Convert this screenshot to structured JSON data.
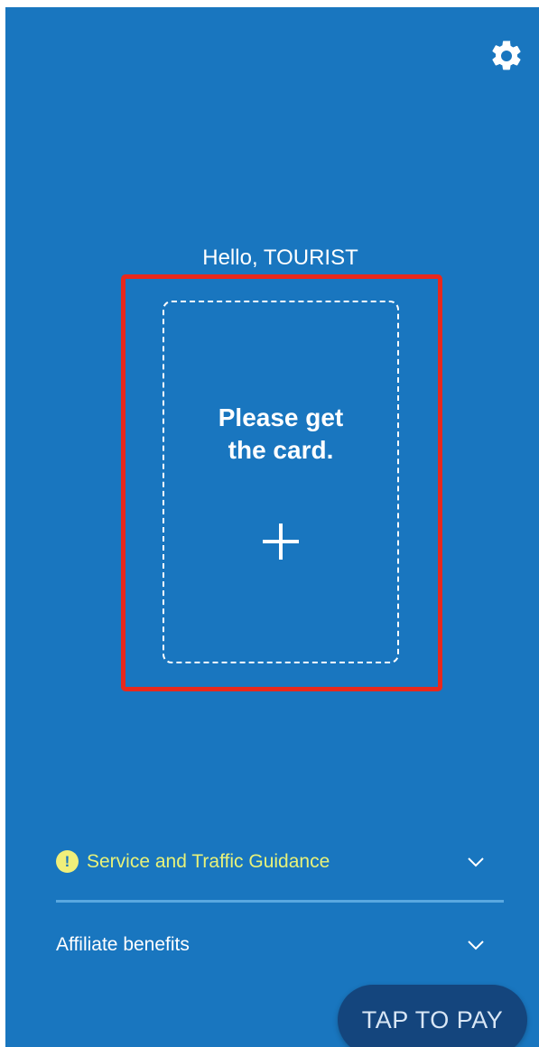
{
  "header": {
    "settings_icon": "gear-icon"
  },
  "greeting": "Hello, TOURIST",
  "card": {
    "line1": "Please get",
    "line2": "the card.",
    "add_icon": "plus-icon"
  },
  "accordion": [
    {
      "label": "Service and Traffic Guidance",
      "icon": "alert-icon",
      "icon_glyph": "!",
      "label_color": "#e8f27a"
    },
    {
      "label": "Affiliate benefits"
    }
  ],
  "pay_button": {
    "label": "TAP TO PAY"
  },
  "colors": {
    "background": "#1976bf",
    "highlight": "#e8281c",
    "pay_button": "#14457d"
  }
}
